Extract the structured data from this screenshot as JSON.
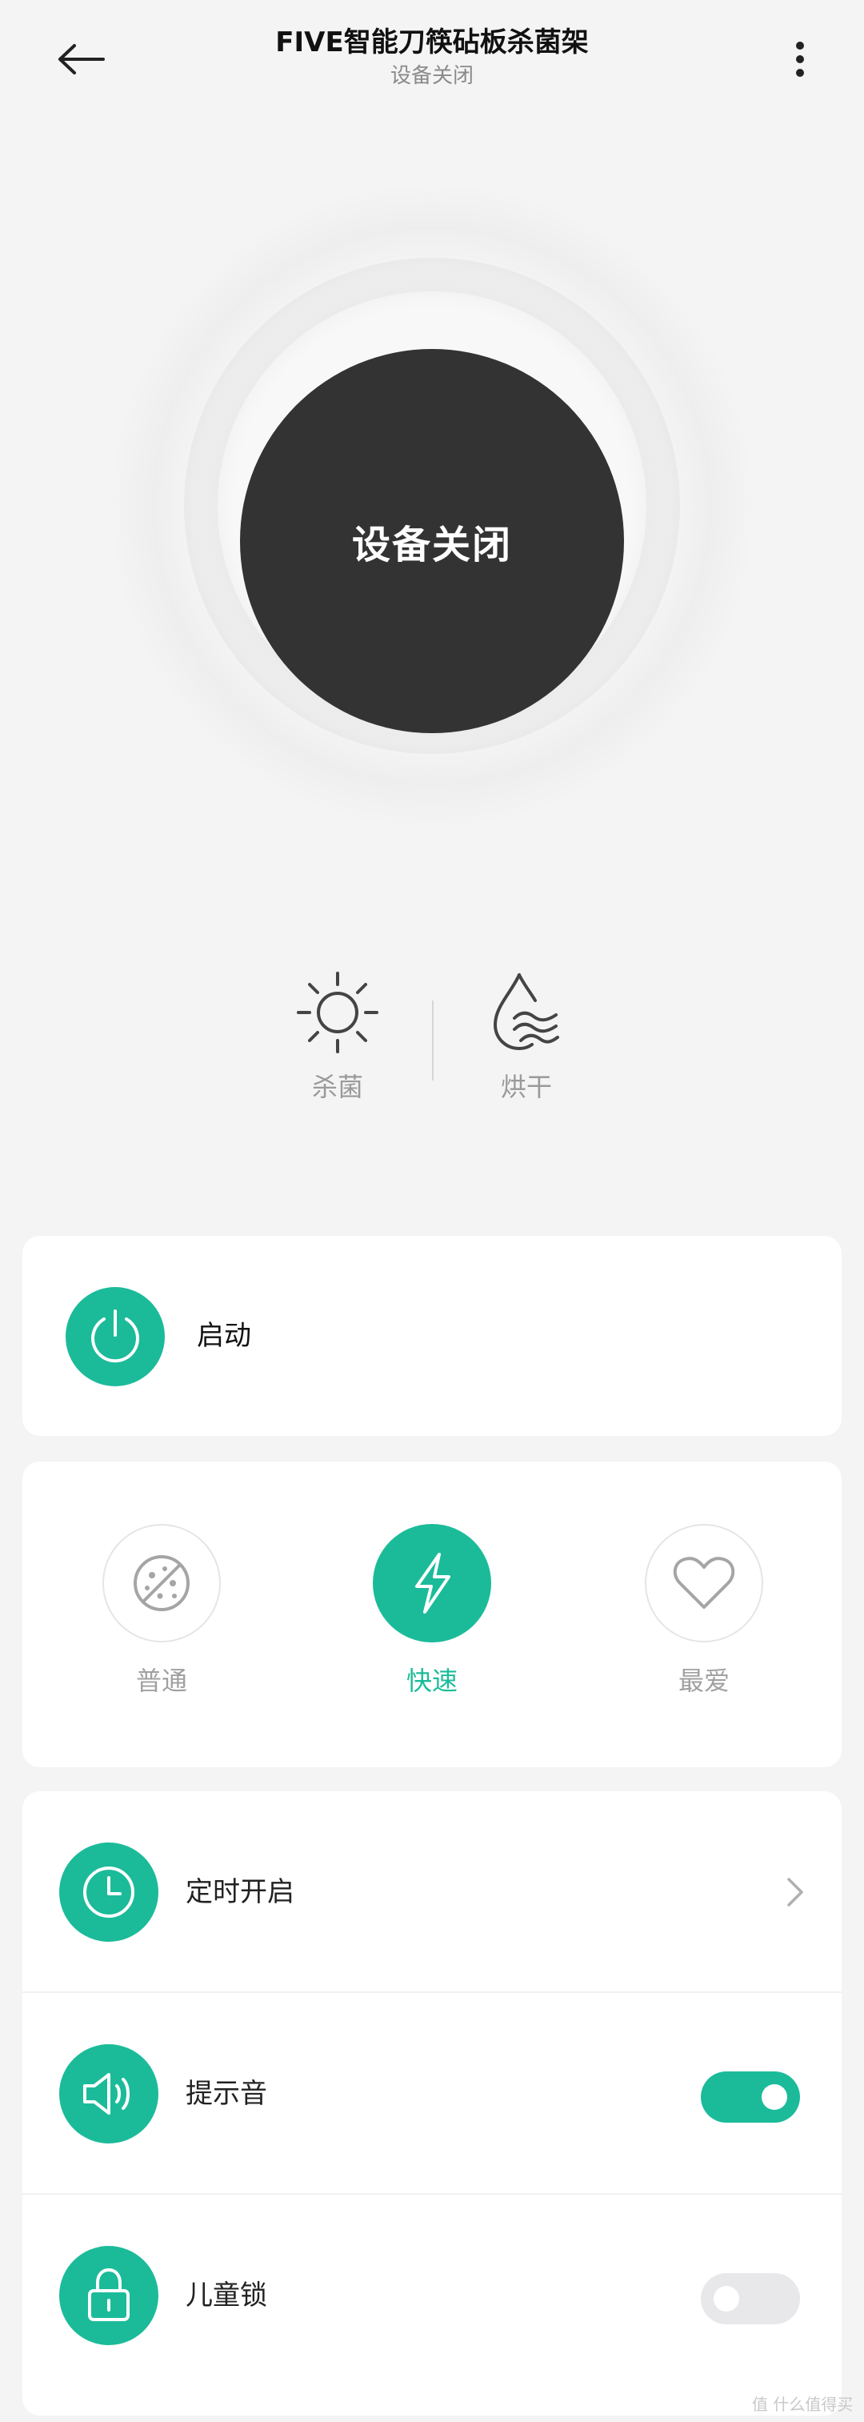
{
  "header": {
    "title": "FIVE智能刀筷砧板杀菌架",
    "subtitle": "设备关闭",
    "back_icon": "arrow-left-icon",
    "more_icon": "more-vertical-icon"
  },
  "hero": {
    "status_text": "设备关闭"
  },
  "functions": [
    {
      "label": "杀菌",
      "icon": "sun-icon"
    },
    {
      "label": "烘干",
      "icon": "water-drop-icon"
    }
  ],
  "start_card": {
    "label": "启动",
    "icon": "power-icon"
  },
  "modes": [
    {
      "label": "普通",
      "icon": "no-germ-icon",
      "active": false
    },
    {
      "label": "快速",
      "icon": "lightning-icon",
      "active": true
    },
    {
      "label": "最爱",
      "icon": "heart-icon",
      "active": false
    }
  ],
  "settings": [
    {
      "label": "定时开启",
      "icon": "clock-icon",
      "control": "chevron"
    },
    {
      "label": "提示音",
      "icon": "speaker-icon",
      "control": "toggle",
      "on": true
    },
    {
      "label": "儿童锁",
      "icon": "lock-icon",
      "control": "toggle",
      "on": false
    }
  ],
  "colors": {
    "accent": "#1bbb9a",
    "power_circle": "#333333",
    "background": "#f4f4f4"
  },
  "watermark": "值 什么值得买"
}
